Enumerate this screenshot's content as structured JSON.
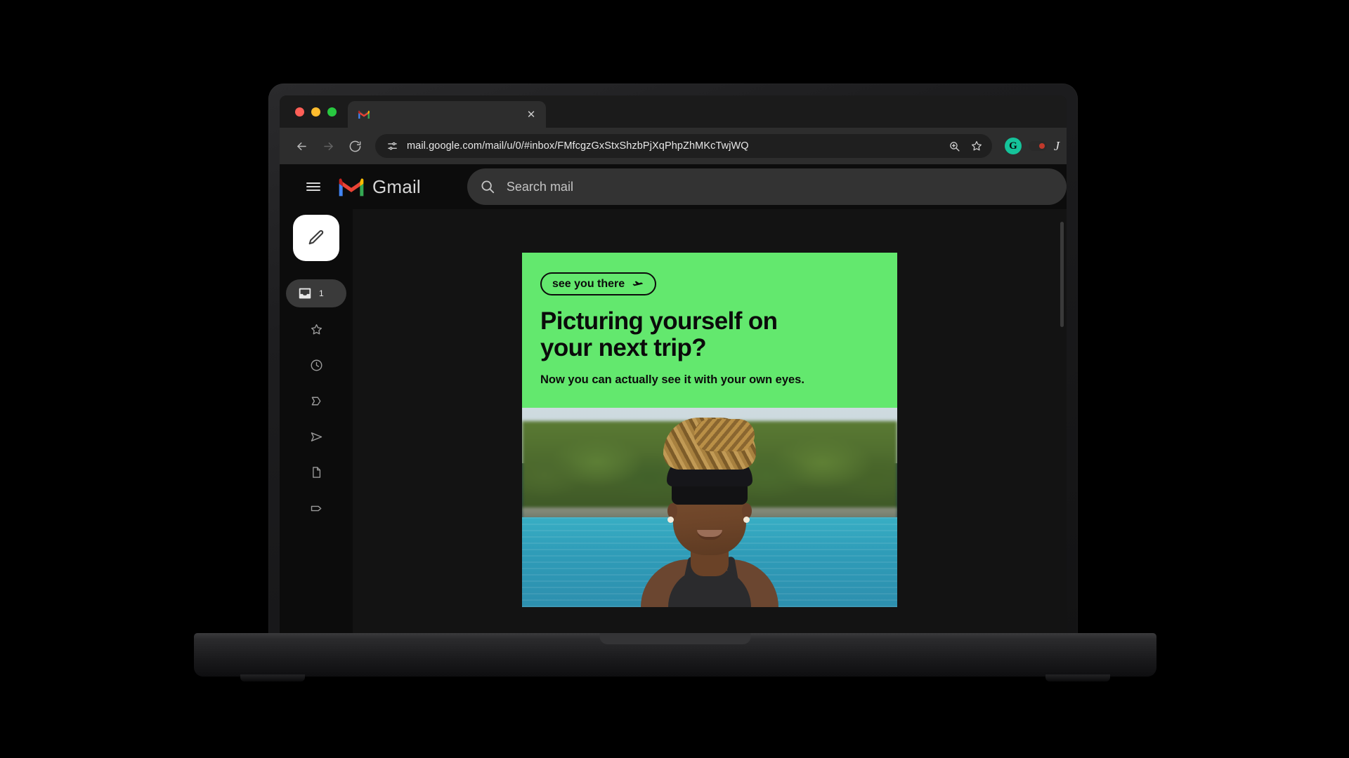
{
  "browser": {
    "traffic_lights": [
      "close",
      "minimize",
      "maximize"
    ],
    "tab": {
      "title": "",
      "favicon": "gmail-favicon",
      "close_label": "✕"
    },
    "nav": {
      "back": "←",
      "forward": "→",
      "reload": "⟳"
    },
    "omnibox": {
      "url": "mail.google.com/mail/u/0/#inbox/FMfcgzGxStxShzbPjXqPhpZhMKcTwjWQ",
      "site_settings_icon": "tune-icon",
      "zoom_icon": "zoom-in-icon",
      "bookmark_icon": "star-icon"
    },
    "extensions": [
      {
        "name": "grammarly",
        "letter": "G",
        "color": "#15c39a"
      },
      {
        "name": "dark-reader-toggle"
      },
      {
        "name": "profile-avatar",
        "letter": "J"
      }
    ]
  },
  "gmail": {
    "brand": "Gmail",
    "menu_icon": "hamburger-icon",
    "search": {
      "placeholder": "Search mail",
      "icon": "search-icon"
    },
    "compose": {
      "icon": "pencil-icon",
      "label": "Compose"
    },
    "rail": [
      {
        "id": "inbox",
        "icon": "inbox-icon",
        "label": "Inbox",
        "count": "1",
        "active": true
      },
      {
        "id": "starred",
        "icon": "star-icon",
        "label": "Starred",
        "active": false
      },
      {
        "id": "snoozed",
        "icon": "clock-icon",
        "label": "Snoozed",
        "active": false
      },
      {
        "id": "important",
        "icon": "important-chevron-icon",
        "label": "Important",
        "active": false
      },
      {
        "id": "sent",
        "icon": "send-icon",
        "label": "Sent",
        "active": false
      },
      {
        "id": "drafts",
        "icon": "document-icon",
        "label": "Drafts",
        "active": false
      },
      {
        "id": "labels",
        "icon": "tag-icon",
        "label": "Labels",
        "active": false
      }
    ]
  },
  "email": {
    "promo": {
      "pill_text": "see you there",
      "pill_icon": "airplane-icon",
      "headline_line1": "Picturing yourself on",
      "headline_line2": "your next trip?",
      "subtext": "Now you can actually see it with your own eyes.",
      "background_color": "#63e86e",
      "text_color": "#0b0b0b"
    },
    "photo": {
      "alt": "Woman with braided updo and sunglasses in front of turquoise water and tropical trees"
    }
  }
}
